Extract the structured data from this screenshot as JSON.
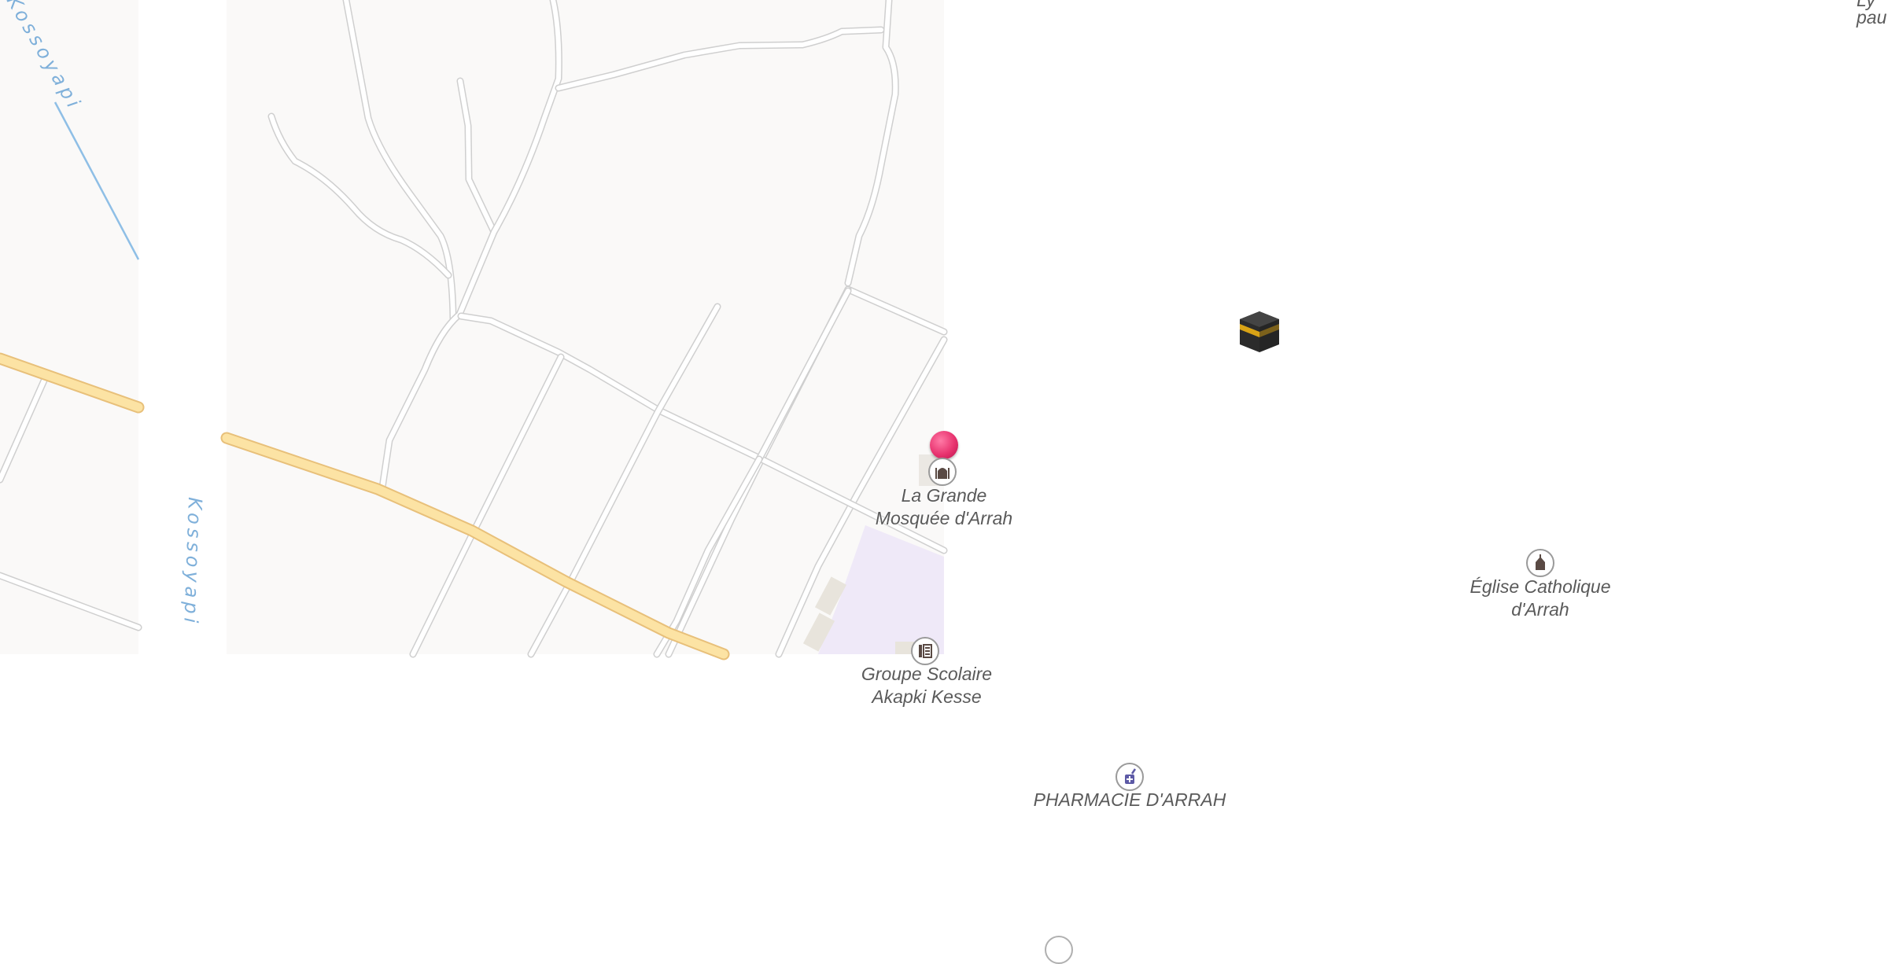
{
  "map": {
    "river_labels": [
      "Kossoyapi",
      "Kossoyapi"
    ],
    "selected_place": "La Grande Mosquée d'Arrah",
    "colors": {
      "land": "#faf9f8",
      "road": "#ffffff",
      "main_road": "#fce3a4",
      "water": "#8fbfe6",
      "marker": "#e8336f",
      "school_area": "#efe9f8"
    },
    "pois": [
      {
        "name": "La Grande Mosquée d'Arrah",
        "icon": "place-of-worship-icon"
      },
      {
        "name": "Groupe Scolaire Akapki Kesse",
        "icon": "school-icon"
      },
      {
        "name": "Église Catholique d'Arrah",
        "icon": "place-of-worship-icon"
      },
      {
        "name": "PHARMACIE D'ARRAH",
        "icon": "pharmacy-icon"
      }
    ],
    "edge_text": [
      "Ly",
      "pau"
    ],
    "kaaba_icon": "kaaba-icon"
  }
}
